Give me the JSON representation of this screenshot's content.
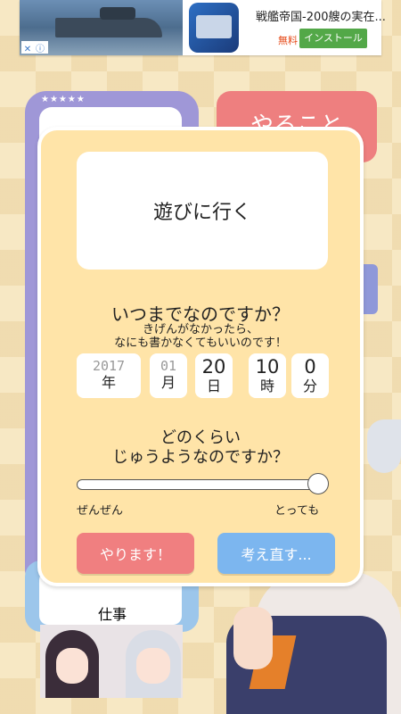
{
  "ad": {
    "title": "戦艦帝国-200艘の実在...",
    "free": "無料",
    "install": "インストール"
  },
  "background": {
    "right_card": "やること",
    "left_bottom_label": "仕事"
  },
  "modal": {
    "task_name": "遊びに行く",
    "deadline_question": "いつまでなのですか？",
    "hint_line1": "きげんがなかったら、",
    "hint_line2": "なにも書かなくてもいいのです！",
    "date": {
      "year": "2017",
      "year_unit": "年",
      "month": "01",
      "month_unit": "月",
      "day": "20",
      "day_unit": "日",
      "hour": "10",
      "hour_unit": "時",
      "minute": "0",
      "minute_unit": "分"
    },
    "importance_line1": "どのくらい",
    "importance_line2": "じゅうようなのですか？",
    "importance_value": 1.0,
    "slider_low": "ぜんぜん",
    "slider_high": "とっても",
    "confirm_button": "やります！",
    "reconsider_button": "考え直す..."
  },
  "colors": {
    "modal_bg": "#ffe4a8",
    "confirm": "#f07f80",
    "reconsider": "#7cb6ef"
  }
}
